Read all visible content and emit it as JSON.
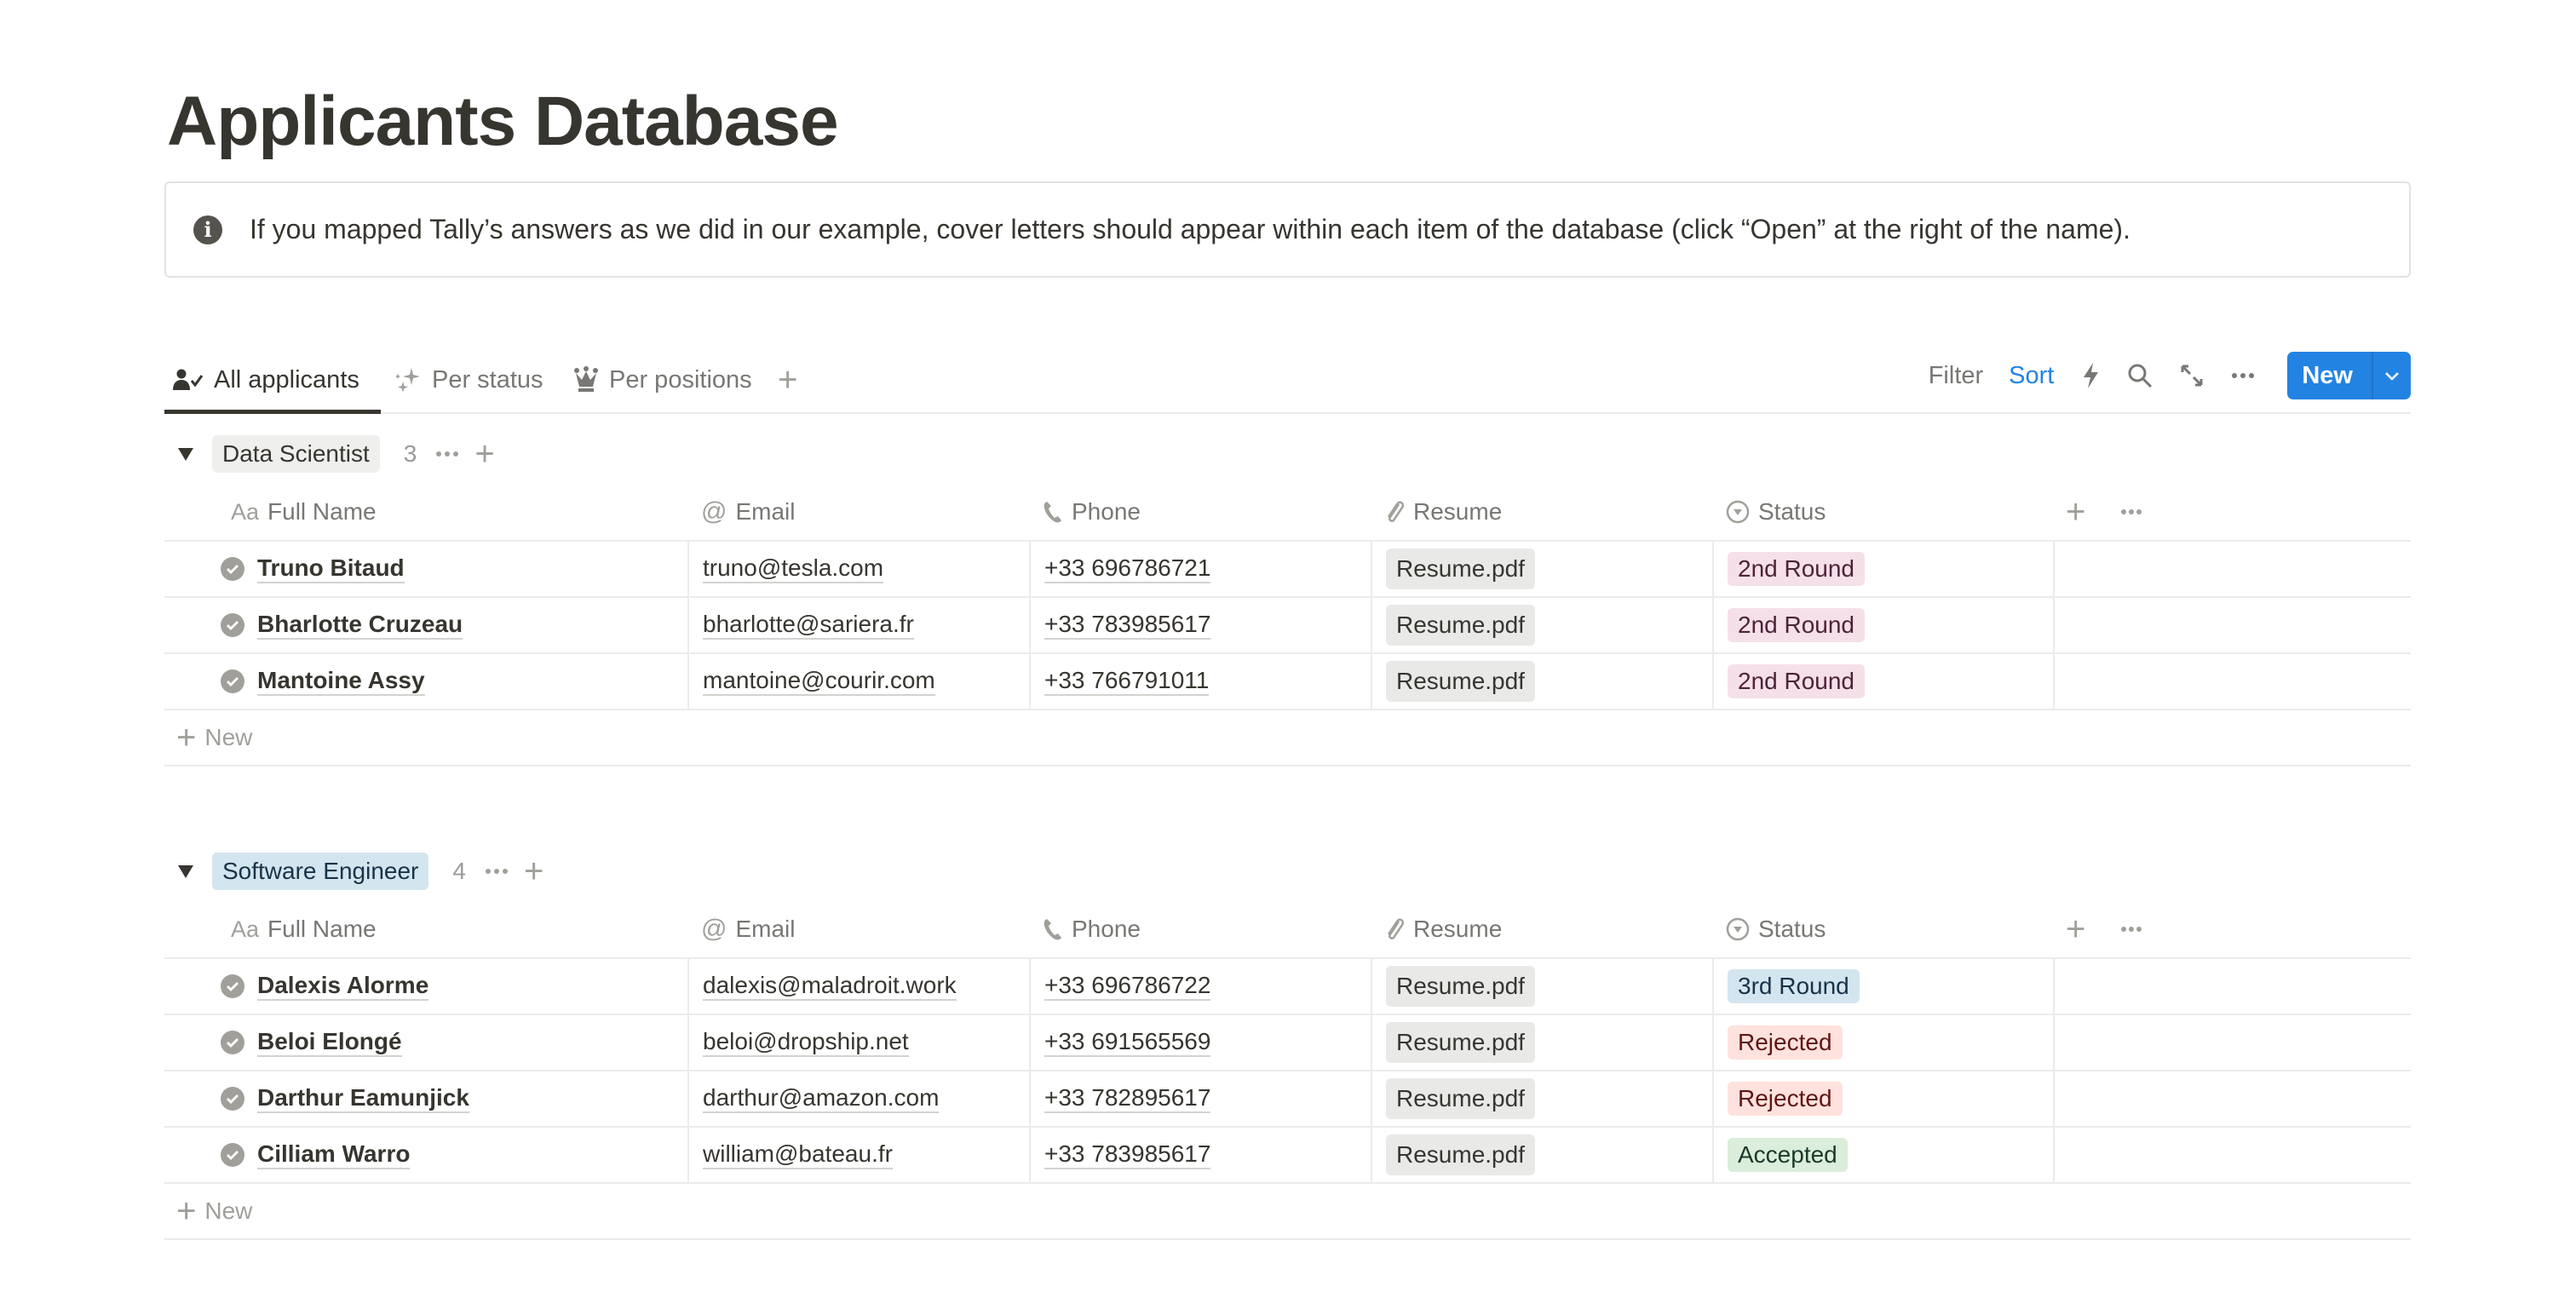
{
  "page": {
    "title": "Applicants Database",
    "callout": {
      "icon": "info-icon",
      "text": "If you mapped Tally’s answers as we did in our example, cover letters should appear within each item of the database (click “Open” at the right of the name)."
    }
  },
  "views": {
    "tabs": [
      {
        "label": "All applicants",
        "icon": "person-check-icon",
        "active": true
      },
      {
        "label": "Per status",
        "icon": "sparkles-icon",
        "active": false
      },
      {
        "label": "Per positions",
        "icon": "crown-icon",
        "active": false
      }
    ],
    "add_view_label": "+"
  },
  "toolbar": {
    "filter_label": "Filter",
    "sort_label": "Sort",
    "new_label": "New",
    "accent_color": "#2383e2"
  },
  "columns": [
    {
      "label": "Full Name",
      "icon": "Aa"
    },
    {
      "label": "Email",
      "icon": "@"
    },
    {
      "label": "Phone",
      "icon": "phone-icon"
    },
    {
      "label": "Resume",
      "icon": "paperclip-icon"
    },
    {
      "label": "Status",
      "icon": "select-icon"
    }
  ],
  "groups": [
    {
      "name": "Data Scientist",
      "count": "3",
      "tag_bg": "#efefed",
      "tag_color": "#37352f",
      "rows": [
        {
          "name": "Truno Bitaud",
          "email": "truno@tesla.com",
          "phone": "+33 696786721",
          "resume": "Resume.pdf",
          "status": "2nd Round",
          "status_bg": "#f5e0e9",
          "status_color": "#4c2337"
        },
        {
          "name": "Bharlotte Cruzeau",
          "email": "bharlotte@sariera.fr",
          "phone": "+33 783985617",
          "resume": "Resume.pdf",
          "status": "2nd Round",
          "status_bg": "#f5e0e9",
          "status_color": "#4c2337"
        },
        {
          "name": "Mantoine Assy",
          "email": "mantoine@courir.com",
          "phone": "+33 766791011",
          "resume": "Resume.pdf",
          "status": "2nd Round",
          "status_bg": "#f5e0e9",
          "status_color": "#4c2337"
        }
      ],
      "new_label": "New"
    },
    {
      "name": "Software Engineer",
      "count": "4",
      "tag_bg": "#d3e5ef",
      "tag_color": "#183347",
      "rows": [
        {
          "name": "Dalexis Alorme",
          "email": "dalexis@maladroit.work",
          "phone": "+33 696786722",
          "resume": "Resume.pdf",
          "status": "3rd Round",
          "status_bg": "#d3e5ef",
          "status_color": "#183347"
        },
        {
          "name": "Beloi Elongé",
          "email": "beloi@dropship.net",
          "phone": "+33 691565569",
          "resume": "Resume.pdf",
          "status": "Rejected",
          "status_bg": "#ffe2dd",
          "status_color": "#5d1715"
        },
        {
          "name": "Darthur Eamunjick",
          "email": "darthur@amazon.com",
          "phone": "+33 782895617",
          "resume": "Resume.pdf",
          "status": "Rejected",
          "status_bg": "#ffe2dd",
          "status_color": "#5d1715"
        },
        {
          "name": "Cilliam Warro",
          "email": "william@bateau.fr",
          "phone": "+33 783985617",
          "resume": "Resume.pdf",
          "status": "Accepted",
          "status_bg": "#dbeddb",
          "status_color": "#1c3829"
        }
      ],
      "new_label": "New"
    }
  ]
}
